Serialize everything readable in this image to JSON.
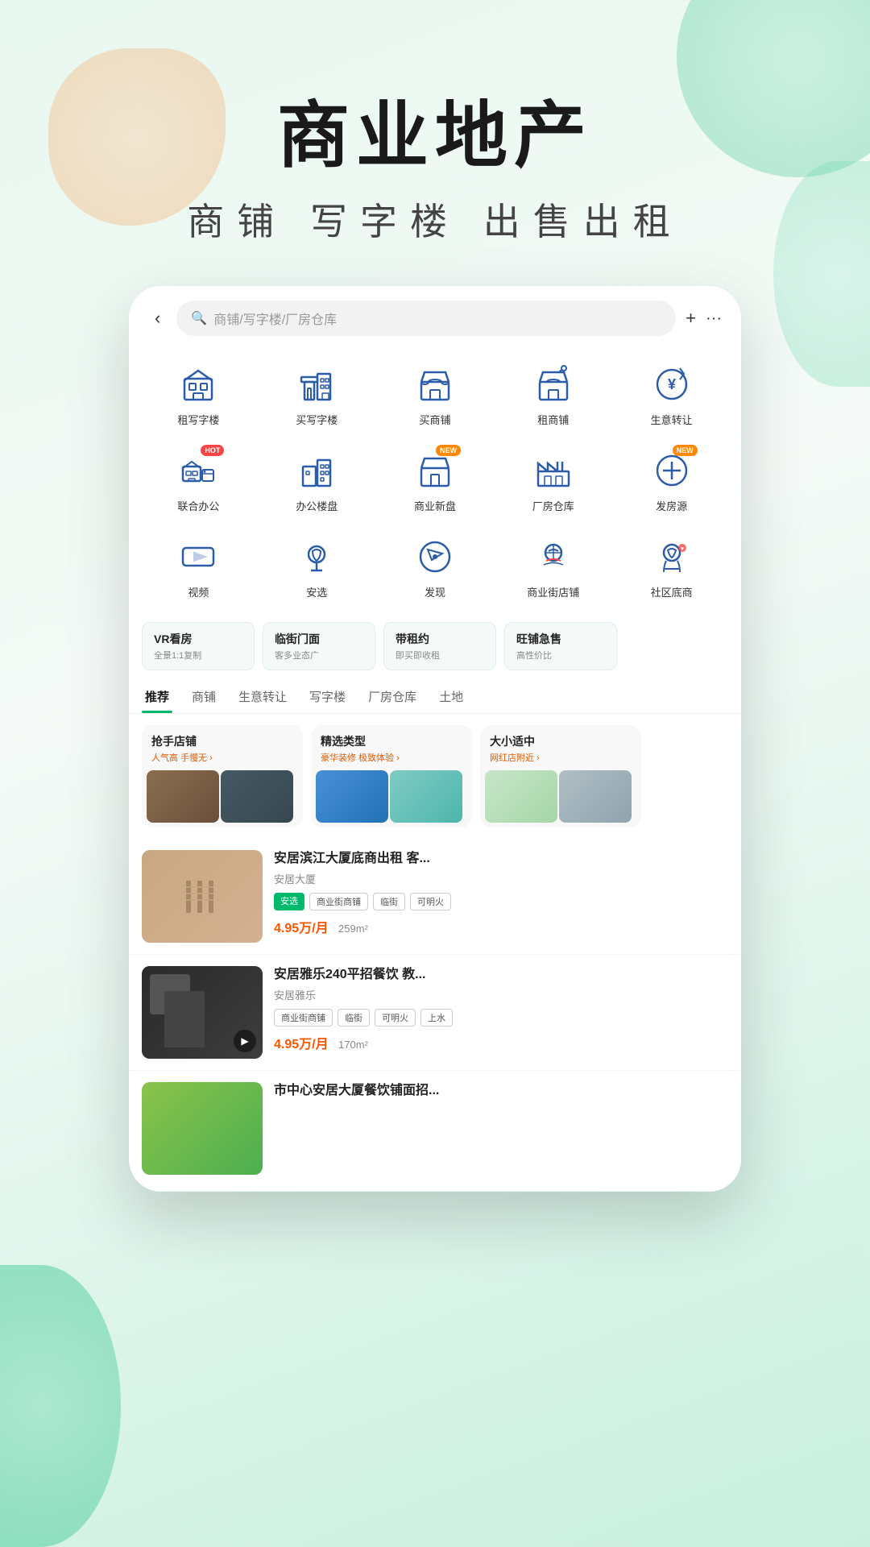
{
  "page": {
    "title": "商业地产",
    "subtitle": "商铺  写字楼  出售出租"
  },
  "topbar": {
    "back_label": "‹",
    "search_placeholder": "商铺/写字楼/厂房仓库",
    "plus_label": "+",
    "message_label": "···"
  },
  "grid_icons": [
    {
      "id": "rent-office",
      "label": "租写字楼",
      "badge": null
    },
    {
      "id": "buy-office",
      "label": "买写字楼",
      "badge": null
    },
    {
      "id": "buy-shop",
      "label": "买商铺",
      "badge": null
    },
    {
      "id": "rent-shop",
      "label": "租商铺",
      "badge": null
    },
    {
      "id": "business-transfer",
      "label": "生意转让",
      "badge": null
    },
    {
      "id": "coworking",
      "label": "联合办公",
      "badge": "HOT"
    },
    {
      "id": "office-buildings",
      "label": "办公楼盘",
      "badge": null
    },
    {
      "id": "commercial-new",
      "label": "商业新盘",
      "badge": "NEW"
    },
    {
      "id": "factory",
      "label": "厂房仓库",
      "badge": null
    },
    {
      "id": "post-source",
      "label": "发房源",
      "badge": "NEW"
    },
    {
      "id": "video",
      "label": "视频",
      "badge": null
    },
    {
      "id": "anx-select",
      "label": "安选",
      "badge": null
    },
    {
      "id": "discover",
      "label": "发现",
      "badge": null
    },
    {
      "id": "street-shop",
      "label": "商业街店铺",
      "badge": null
    },
    {
      "id": "community-shop",
      "label": "社区底商",
      "badge": null
    }
  ],
  "feature_tags": [
    {
      "title": "VR看房",
      "desc": "全景1:1复制"
    },
    {
      "title": "临街门面",
      "desc": "客多业态广"
    },
    {
      "title": "带租约",
      "desc": "即买即收租"
    },
    {
      "title": "旺铺急售",
      "desc": "高性价比"
    }
  ],
  "tabs": [
    {
      "label": "推荐",
      "active": true
    },
    {
      "label": "商铺",
      "active": false
    },
    {
      "label": "生意转让",
      "active": false
    },
    {
      "label": "写字楼",
      "active": false
    },
    {
      "label": "厂房仓库",
      "active": false
    },
    {
      "label": "土地",
      "active": false
    }
  ],
  "promo_cards": [
    {
      "title": "抢手店铺",
      "subtitle": "人气高 手慢无 ›",
      "images": [
        "img-brown",
        "img-dark"
      ]
    },
    {
      "title": "精选类型",
      "subtitle": "豪华装修 极致体验 ›",
      "images": [
        "img-blue",
        "img-teal"
      ]
    },
    {
      "title": "大小适中",
      "subtitle": "网红店附近 ›",
      "images": [
        "img-light",
        "img-gray"
      ]
    }
  ],
  "listings": [
    {
      "id": "listing-1",
      "title": "安居滨江大厦底商出租 客...",
      "agent": "安居大厦",
      "tags_special": [
        "安选"
      ],
      "tags": [
        "商业街商铺",
        "临街",
        "可明火"
      ],
      "price": "4.95万/月",
      "area": "259m²",
      "thumb_class": "thumb-1",
      "has_video": false
    },
    {
      "id": "listing-2",
      "title": "安居雅乐240平招餐饮 教...",
      "agent": "安居雅乐",
      "tags_special": [],
      "tags": [
        "商业街商铺",
        "临街",
        "可明火",
        "上水"
      ],
      "price": "4.95万/月",
      "area": "170m²",
      "thumb_class": "thumb-2",
      "has_video": true
    },
    {
      "id": "listing-3",
      "title": "市中心安居大厦餐饮铺面招...",
      "agent": "",
      "tags_special": [],
      "tags": [],
      "price": "",
      "area": "",
      "thumb_class": "thumb-3",
      "has_video": false
    }
  ]
}
